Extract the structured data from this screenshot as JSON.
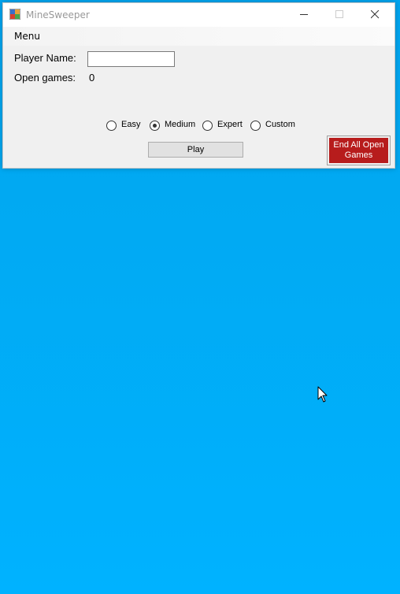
{
  "window": {
    "title": "MineSweeper"
  },
  "menu": {
    "items": [
      {
        "label": "Menu"
      }
    ]
  },
  "form": {
    "player_name_label": "Player Name:",
    "player_name_value": "",
    "open_games_label": "Open games:",
    "open_games_value": "0"
  },
  "difficulty": {
    "options": [
      {
        "label": "Easy",
        "selected": false
      },
      {
        "label": "Medium",
        "selected": true
      },
      {
        "label": "Expert",
        "selected": false
      },
      {
        "label": "Custom",
        "selected": false
      }
    ]
  },
  "buttons": {
    "play_label": "Play",
    "end_all_label": "End All Open Games"
  },
  "colors": {
    "desktop": "#00aaf4",
    "end_button": "#b71c1c"
  },
  "icons": {
    "app": "minesweeper-app-icon",
    "minimize": "minimize-icon",
    "maximize": "maximize-icon",
    "close": "close-icon",
    "cursor": "mouse-pointer-icon"
  }
}
